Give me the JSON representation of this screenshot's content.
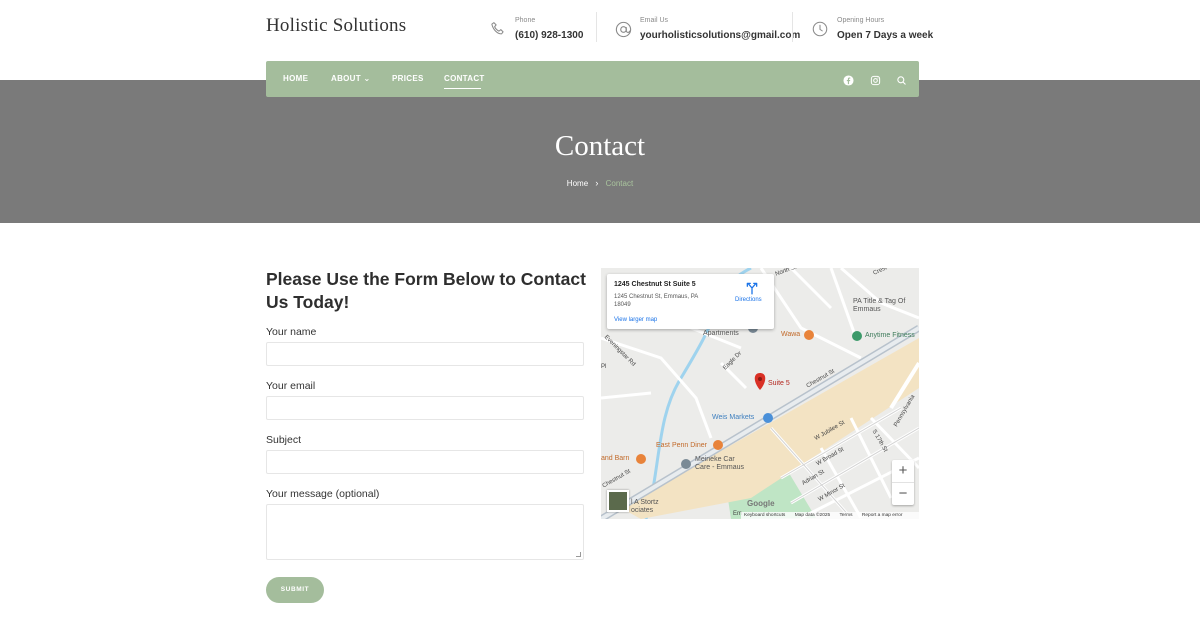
{
  "site": {
    "logo": "Holistic Solutions"
  },
  "header": {
    "phone": {
      "label": "Phone",
      "value": "(610) 928-1300",
      "icon": "phone-icon"
    },
    "email": {
      "label": "Email Us",
      "value": "yourholisticsolutions@gmail.com",
      "icon": "at-icon"
    },
    "hours": {
      "label": "Opening Hours",
      "value": "Open 7 Days a week",
      "icon": "clock-icon"
    }
  },
  "nav": {
    "items": [
      {
        "label": "HOME"
      },
      {
        "label": "ABOUT ⌄"
      },
      {
        "label": "PRICES"
      },
      {
        "label": "CONTACT",
        "active": true
      }
    ],
    "icons": [
      "facebook-icon",
      "instagram-icon",
      "search-icon"
    ]
  },
  "hero": {
    "title": "Contact",
    "breadcrumb": {
      "home": "Home",
      "current": "Contact"
    }
  },
  "form": {
    "title": "Please Use the Form Below to Contact Us Today!",
    "fields": [
      {
        "label": "Your name",
        "value": ""
      },
      {
        "label": "Your email",
        "value": ""
      },
      {
        "label": "Subject",
        "value": ""
      },
      {
        "label": "Your message (optional)",
        "value": ""
      }
    ],
    "submit": "SUBMIT"
  },
  "map": {
    "card": {
      "title": "1245 Chestnut St Suite 5",
      "address": "1245 Chestnut St, Emmaus, PA 18049",
      "larger_map": "View larger map",
      "directions": "Directions"
    },
    "places": {
      "pa_title": "PA Title & Tag Of Emmaus",
      "wawa": "Wawa",
      "anytime": "Anytime Fitness",
      "apartments": "Apartments",
      "suite5": "Suite 5",
      "weis": "Weis Markets",
      "east_penn": "East Penn Diner",
      "barn": "and Barn",
      "meineke1": "Meineke Car",
      "meineke2": "Care - Emmaus",
      "stortz1": "l A Stortz",
      "stortz2": "ociates"
    },
    "roads": {
      "chestnut": "Chestnut St",
      "chestnut2": "Chestnut St",
      "jubilee": "W Jubilee St",
      "broad": "W Broad St",
      "minor": "W Minor St",
      "seventeenth": "S 17th St",
      "pennsylvania": "Pennsylvania",
      "eagle": "Eagle Dr",
      "evening": "Eveningstar Rd",
      "adrian": "Adrian St",
      "north": "North St",
      "crest": "Crest",
      "pl": "Pl",
      "em": "Em"
    },
    "zoom_in": "+",
    "zoom_out": "−",
    "logo": "Google",
    "attribution": {
      "shortcuts": "Keyboard shortcuts",
      "data": "Map data ©2025",
      "terms": "Terms",
      "report": "Report a map error"
    },
    "colors": {
      "accent": "#a4bd9c",
      "pin": "#d93025",
      "route": "#f3e3c3"
    }
  }
}
